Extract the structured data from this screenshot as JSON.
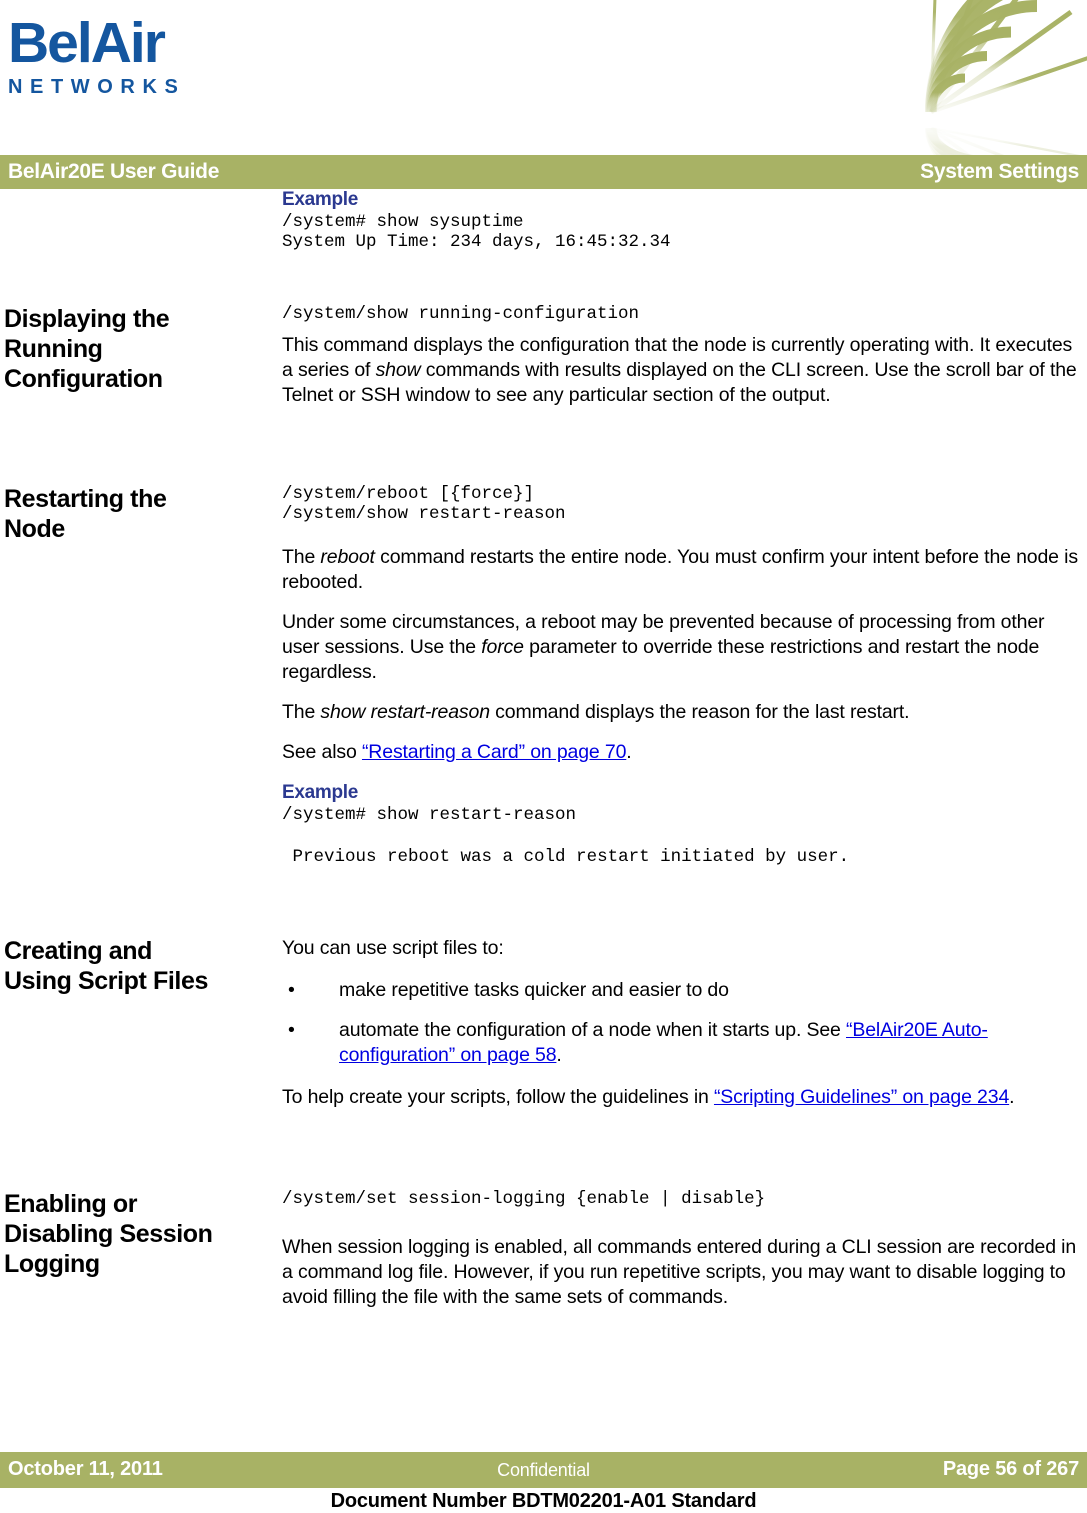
{
  "masthead": {
    "logo_wordmark": "BelAir",
    "logo_subtext": "NETWORKS",
    "logo_color": "#14569f",
    "web_graphic_color": "#a8b265"
  },
  "header": {
    "left": "BelAir20E User Guide",
    "right": "System Settings",
    "band_color": "#a8b265",
    "text_color": "#ffffff"
  },
  "sections": [
    {
      "heading": "",
      "example_label": "Example",
      "code": "/system# show sysuptime\nSystem Up Time: 234 days, 16:45:32.34"
    },
    {
      "heading_line1": "Displaying the",
      "heading_line2": "Running",
      "heading_line3": "Configuration",
      "code": "/system/show running-configuration",
      "paragraph": "This command displays the configuration that the node is currently operating with. It executes a series of show commands with results displayed on the CLI screen. Use the scroll bar of the Telnet or SSH window to see any particular section of the output.",
      "para_pre": "This command displays the configuration that the node is currently operating with. It executes a series of ",
      "para_italic": "show",
      "para_post": " commands with results displayed on the CLI screen. Use the scroll bar of the Telnet or SSH window to see any particular section of the output."
    },
    {
      "heading_line1": "Restarting the",
      "heading_line2": "Node",
      "code": "/system/reboot [{force}]\n/system/show restart-reason",
      "p1_pre": "The ",
      "p1_italic": "reboot",
      "p1_post": " command restarts the entire node. You must confirm your intent before the node is rebooted.",
      "p2_pre": "Under some circumstances, a reboot may be prevented because of processing from other user sessions. Use the ",
      "p2_italic": "force",
      "p2_post": " parameter to override these restrictions and restart the node regardless.",
      "p3_pre": "The ",
      "p3_italic": "show restart-reason",
      "p3_post": " command displays the reason for the last restart.",
      "p4_pre": "See also ",
      "p4_link": "“Restarting a Card” on page 70",
      "p4_post": ".",
      "example_label": "Example",
      "code2": "/system# show restart-reason",
      "code3": " Previous reboot was a cold restart initiated by user."
    },
    {
      "heading_line1": "Creating and",
      "heading_line2": "Using Script Files",
      "intro": "You can use script files to:",
      "bullet_char": "•",
      "bullet1": "make repetitive tasks quicker and easier to do",
      "bullet2_pre": "automate the configuration of a node when it starts up. See ",
      "bullet2_link": "“BelAir20E Auto-configuration” on page 58",
      "bullet2_post": ".",
      "p_pre": "To help create your scripts, follow the guidelines in ",
      "p_link": "“Scripting Guidelines” on page 234",
      "p_post": "."
    },
    {
      "heading_line1": "Enabling or",
      "heading_line2": "Disabling Session",
      "heading_line3": "Logging",
      "code": "/system/set session-logging {enable | disable}",
      "paragraph": "When session logging is enabled, all commands entered during a CLI session are recorded in a command log file. However, if you run repetitive scripts, you may want to disable logging to avoid filling the file with the same sets of commands."
    }
  ],
  "footer": {
    "date": "October 11, 2011",
    "classification": "Confidential",
    "page": "Page 56 of 267",
    "document_number": "Document Number BDTM02201-A01 Standard",
    "band_color": "#a8b265"
  },
  "colors": {
    "accent_green": "#a8b265",
    "brand_blue": "#14569f",
    "example_blue": "#2b3990",
    "link_blue": "#0000e0"
  }
}
